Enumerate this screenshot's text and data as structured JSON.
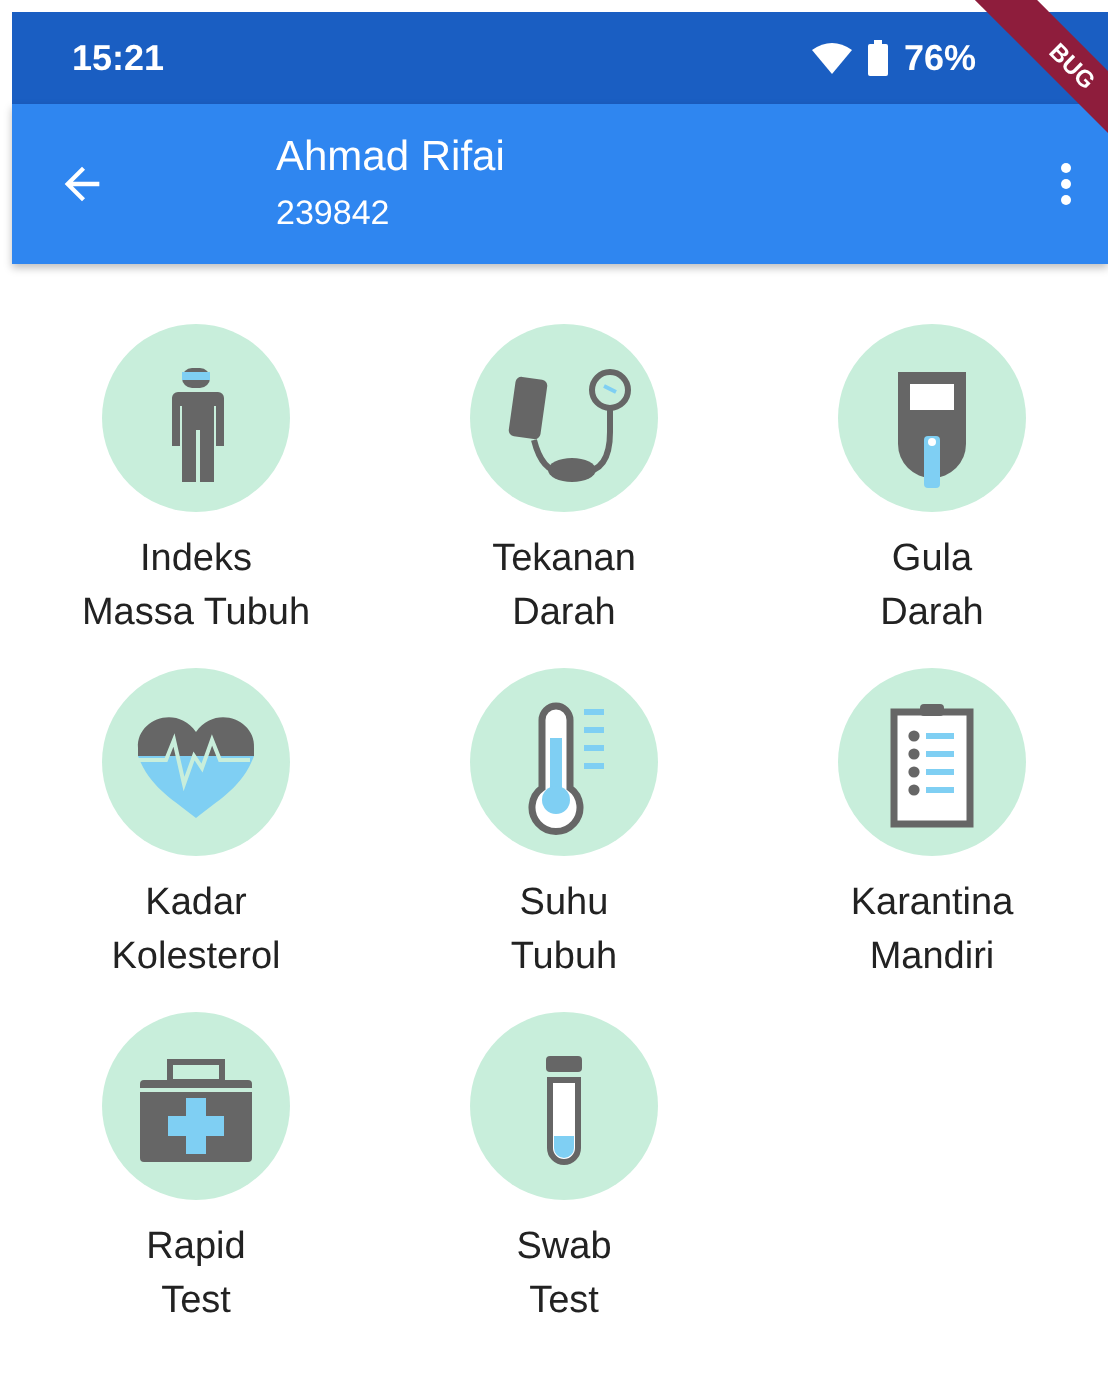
{
  "status_bar": {
    "time": "15:21",
    "battery": "76%"
  },
  "debug_banner": {
    "label": "BUG"
  },
  "app_bar": {
    "title": "Ahmad Rifai",
    "subtitle": "239842"
  },
  "menu_items": [
    {
      "kind": "person",
      "label": "Indeks\nMassa Tubuh"
    },
    {
      "kind": "blood-pressure",
      "label": "Tekanan\nDarah"
    },
    {
      "kind": "glucose-meter",
      "label": "Gula\nDarah"
    },
    {
      "kind": "heart",
      "label": "Kadar\nKolesterol"
    },
    {
      "kind": "thermometer",
      "label": "Suhu\nTubuh"
    },
    {
      "kind": "clipboard",
      "label": "Karantina\nMandiri"
    },
    {
      "kind": "medical-kit",
      "label": "Rapid\nTest"
    },
    {
      "kind": "test-tube",
      "label": "Swab\nTest"
    }
  ]
}
